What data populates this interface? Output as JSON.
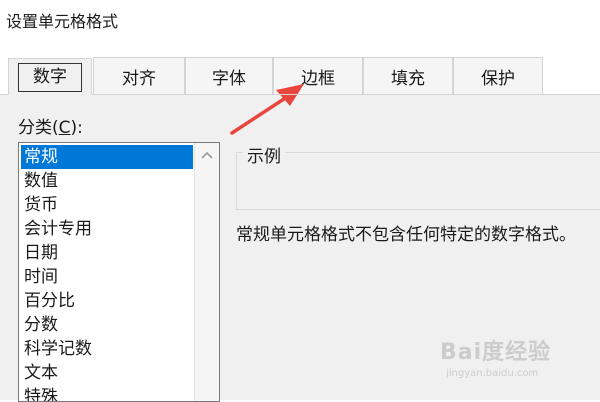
{
  "window": {
    "title": "设置单元格格式"
  },
  "tabs": [
    {
      "label": "数字",
      "active": true
    },
    {
      "label": "对齐",
      "active": false
    },
    {
      "label": "字体",
      "active": false
    },
    {
      "label": "边框",
      "active": false
    },
    {
      "label": "填充",
      "active": false
    },
    {
      "label": "保护",
      "active": false
    }
  ],
  "category": {
    "label_prefix": "分类(",
    "label_hotkey": "C",
    "label_suffix": "):",
    "items": [
      "常规",
      "数值",
      "货币",
      "会计专用",
      "日期",
      "时间",
      "百分比",
      "分数",
      "科学记数",
      "文本",
      "特殊"
    ],
    "selected": "常规"
  },
  "sample": {
    "legend": "示例"
  },
  "description": "常规单元格格式不包含任何特定的数字格式。",
  "annotation": {
    "type": "red-arrow",
    "target": "tab-border",
    "color": "#e8463c"
  },
  "watermark": {
    "brand": "Bai度经验",
    "url": "jingyan.baidu.com"
  },
  "colors": {
    "selection": "#0078d7",
    "dialog_bg": "#f0f0f0"
  }
}
